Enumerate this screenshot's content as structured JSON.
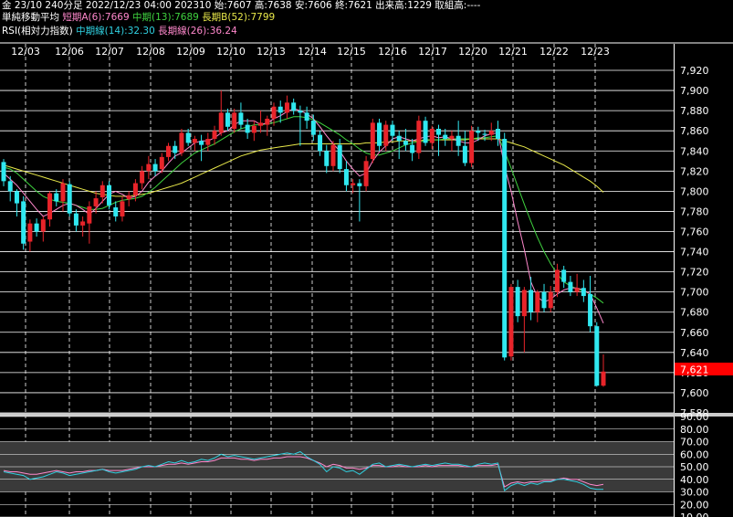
{
  "header": {
    "line1": {
      "instrument": "金 23/10 240分足",
      "datetime": "2022/12/23 04:00",
      "code": "202310",
      "open": "始:7607",
      "high": "高:7638",
      "low": "安:7606",
      "close": "終:7621",
      "volume": "出来高:1229",
      "turnover": "取組高:----"
    },
    "line2": {
      "label": "単純移動平均",
      "short": "短期A(6):7669",
      "mid": "中期(13):7689",
      "long": "長期B(52):7799"
    },
    "line3": {
      "label": "RSI(相対力指数)",
      "mid": "中期線(14):32.30",
      "long": "長期線(26):36.24"
    }
  },
  "colors": {
    "background": "#000000",
    "grid": "#ffffff",
    "candle_up": "#e8242a",
    "candle_down": "#30e8f0",
    "ma_short": "#ff88cc",
    "ma_mid": "#3fd23f",
    "ma_long": "#e8e84a",
    "rsi_mid": "#30d0e0",
    "rsi_long": "#ff88cc",
    "price_marker": "#ff0000"
  },
  "current_price_label": "7,621",
  "chart_data": [
    {
      "type": "candlestick",
      "title": "金 23/10 240分足",
      "date_labels": [
        "12/03",
        "12/06",
        "12/07",
        "12/08",
        "12/09",
        "12/10",
        "12/13",
        "12/14",
        "12/15",
        "12/16",
        "12/17",
        "12/20",
        "12/21",
        "12/22",
        "12/23"
      ],
      "ylim": [
        7580,
        7930
      ],
      "y_ticks": [
        "7,920",
        "7,900",
        "7,880",
        "7,860",
        "7,840",
        "7,820",
        "7,800",
        "7,780",
        "7,760",
        "7,740",
        "7,720",
        "7,700",
        "7,680",
        "7,660",
        "7,640",
        "7,620",
        "7,600",
        "7,580"
      ],
      "candles": [
        {
          "o": 7829,
          "h": 7832,
          "l": 7805,
          "c": 7810
        },
        {
          "o": 7810,
          "h": 7815,
          "l": 7790,
          "c": 7800
        },
        {
          "o": 7800,
          "h": 7802,
          "l": 7775,
          "c": 7788
        },
        {
          "o": 7790,
          "h": 7795,
          "l": 7742,
          "c": 7748
        },
        {
          "o": 7750,
          "h": 7772,
          "l": 7740,
          "c": 7768
        },
        {
          "o": 7768,
          "h": 7773,
          "l": 7755,
          "c": 7760
        },
        {
          "o": 7760,
          "h": 7775,
          "l": 7750,
          "c": 7772
        },
        {
          "o": 7772,
          "h": 7800,
          "l": 7765,
          "c": 7798
        },
        {
          "o": 7798,
          "h": 7802,
          "l": 7785,
          "c": 7790
        },
        {
          "o": 7790,
          "h": 7812,
          "l": 7780,
          "c": 7808
        },
        {
          "o": 7807,
          "h": 7810,
          "l": 7775,
          "c": 7778
        },
        {
          "o": 7778,
          "h": 7782,
          "l": 7760,
          "c": 7766
        },
        {
          "o": 7766,
          "h": 7775,
          "l": 7755,
          "c": 7770
        },
        {
          "o": 7768,
          "h": 7790,
          "l": 7748,
          "c": 7785
        },
        {
          "o": 7785,
          "h": 7800,
          "l": 7778,
          "c": 7793
        },
        {
          "o": 7794,
          "h": 7810,
          "l": 7788,
          "c": 7806
        },
        {
          "o": 7806,
          "h": 7810,
          "l": 7782,
          "c": 7786
        },
        {
          "o": 7784,
          "h": 7790,
          "l": 7770,
          "c": 7775
        },
        {
          "o": 7775,
          "h": 7795,
          "l": 7770,
          "c": 7790
        },
        {
          "o": 7792,
          "h": 7800,
          "l": 7785,
          "c": 7796
        },
        {
          "o": 7796,
          "h": 7812,
          "l": 7790,
          "c": 7808
        },
        {
          "o": 7808,
          "h": 7825,
          "l": 7802,
          "c": 7820
        },
        {
          "o": 7820,
          "h": 7835,
          "l": 7812,
          "c": 7827
        },
        {
          "o": 7827,
          "h": 7832,
          "l": 7815,
          "c": 7820
        },
        {
          "o": 7822,
          "h": 7838,
          "l": 7818,
          "c": 7834
        },
        {
          "o": 7834,
          "h": 7848,
          "l": 7830,
          "c": 7845
        },
        {
          "o": 7845,
          "h": 7850,
          "l": 7832,
          "c": 7838
        },
        {
          "o": 7838,
          "h": 7862,
          "l": 7835,
          "c": 7858
        },
        {
          "o": 7858,
          "h": 7862,
          "l": 7845,
          "c": 7848
        },
        {
          "o": 7848,
          "h": 7855,
          "l": 7840,
          "c": 7852
        },
        {
          "o": 7850,
          "h": 7856,
          "l": 7830,
          "c": 7846
        },
        {
          "o": 7846,
          "h": 7858,
          "l": 7840,
          "c": 7852
        },
        {
          "o": 7852,
          "h": 7865,
          "l": 7846,
          "c": 7860
        },
        {
          "o": 7858,
          "h": 7900,
          "l": 7855,
          "c": 7878
        },
        {
          "o": 7878,
          "h": 7882,
          "l": 7860,
          "c": 7864
        },
        {
          "o": 7862,
          "h": 7882,
          "l": 7858,
          "c": 7878
        },
        {
          "o": 7878,
          "h": 7888,
          "l": 7862,
          "c": 7866
        },
        {
          "o": 7866,
          "h": 7872,
          "l": 7852,
          "c": 7858
        },
        {
          "o": 7858,
          "h": 7870,
          "l": 7850,
          "c": 7865
        },
        {
          "o": 7865,
          "h": 7880,
          "l": 7858,
          "c": 7868
        },
        {
          "o": 7866,
          "h": 7875,
          "l": 7855,
          "c": 7872
        },
        {
          "o": 7872,
          "h": 7888,
          "l": 7865,
          "c": 7884
        },
        {
          "o": 7884,
          "h": 7890,
          "l": 7868,
          "c": 7878
        },
        {
          "o": 7878,
          "h": 7895,
          "l": 7872,
          "c": 7888
        },
        {
          "o": 7888,
          "h": 7892,
          "l": 7876,
          "c": 7880
        },
        {
          "o": 7880,
          "h": 7885,
          "l": 7845,
          "c": 7878
        },
        {
          "o": 7878,
          "h": 7884,
          "l": 7862,
          "c": 7870
        },
        {
          "o": 7870,
          "h": 7876,
          "l": 7850,
          "c": 7856
        },
        {
          "o": 7856,
          "h": 7860,
          "l": 7835,
          "c": 7840
        },
        {
          "o": 7840,
          "h": 7846,
          "l": 7818,
          "c": 7825
        },
        {
          "o": 7825,
          "h": 7850,
          "l": 7820,
          "c": 7846
        },
        {
          "o": 7846,
          "h": 7852,
          "l": 7818,
          "c": 7822
        },
        {
          "o": 7822,
          "h": 7830,
          "l": 7800,
          "c": 7806
        },
        {
          "o": 7806,
          "h": 7812,
          "l": 7798,
          "c": 7808
        },
        {
          "o": 7808,
          "h": 7812,
          "l": 7770,
          "c": 7805
        },
        {
          "o": 7805,
          "h": 7835,
          "l": 7800,
          "c": 7830
        },
        {
          "o": 7832,
          "h": 7872,
          "l": 7828,
          "c": 7868
        },
        {
          "o": 7868,
          "h": 7872,
          "l": 7840,
          "c": 7845
        },
        {
          "o": 7845,
          "h": 7870,
          "l": 7840,
          "c": 7866
        },
        {
          "o": 7866,
          "h": 7870,
          "l": 7850,
          "c": 7855
        },
        {
          "o": 7855,
          "h": 7860,
          "l": 7832,
          "c": 7850
        },
        {
          "o": 7850,
          "h": 7862,
          "l": 7840,
          "c": 7846
        },
        {
          "o": 7846,
          "h": 7852,
          "l": 7830,
          "c": 7838
        },
        {
          "o": 7838,
          "h": 7875,
          "l": 7832,
          "c": 7870
        },
        {
          "o": 7870,
          "h": 7874,
          "l": 7845,
          "c": 7848
        },
        {
          "o": 7848,
          "h": 7865,
          "l": 7842,
          "c": 7862
        },
        {
          "o": 7862,
          "h": 7866,
          "l": 7835,
          "c": 7856
        },
        {
          "o": 7856,
          "h": 7862,
          "l": 7845,
          "c": 7852
        },
        {
          "o": 7852,
          "h": 7860,
          "l": 7840,
          "c": 7855
        },
        {
          "o": 7855,
          "h": 7870,
          "l": 7835,
          "c": 7845
        },
        {
          "o": 7845,
          "h": 7860,
          "l": 7825,
          "c": 7828
        },
        {
          "o": 7828,
          "h": 7865,
          "l": 7824,
          "c": 7860
        },
        {
          "o": 7860,
          "h": 7864,
          "l": 7850,
          "c": 7858
        },
        {
          "o": 7857,
          "h": 7861,
          "l": 7850,
          "c": 7856
        },
        {
          "o": 7856,
          "h": 7868,
          "l": 7850,
          "c": 7860
        },
        {
          "o": 7862,
          "h": 7870,
          "l": 7845,
          "c": 7852
        },
        {
          "o": 7852,
          "h": 7858,
          "l": 7632,
          "c": 7635
        },
        {
          "o": 7636,
          "h": 7708,
          "l": 7632,
          "c": 7705
        },
        {
          "o": 7705,
          "h": 7712,
          "l": 7670,
          "c": 7676
        },
        {
          "o": 7676,
          "h": 7705,
          "l": 7640,
          "c": 7702
        },
        {
          "o": 7702,
          "h": 7715,
          "l": 7672,
          "c": 7680
        },
        {
          "o": 7680,
          "h": 7702,
          "l": 7670,
          "c": 7700
        },
        {
          "o": 7700,
          "h": 7708,
          "l": 7680,
          "c": 7684
        },
        {
          "o": 7684,
          "h": 7706,
          "l": 7680,
          "c": 7700
        },
        {
          "o": 7700,
          "h": 7728,
          "l": 7695,
          "c": 7722
        },
        {
          "o": 7722,
          "h": 7726,
          "l": 7704,
          "c": 7710
        },
        {
          "o": 7710,
          "h": 7716,
          "l": 7696,
          "c": 7700
        },
        {
          "o": 7700,
          "h": 7718,
          "l": 7696,
          "c": 7704
        },
        {
          "o": 7704,
          "h": 7712,
          "l": 7690,
          "c": 7696
        },
        {
          "o": 7698,
          "h": 7716,
          "l": 7660,
          "c": 7666
        },
        {
          "o": 7666,
          "h": 7670,
          "l": 7606,
          "c": 7607
        },
        {
          "o": 7607,
          "h": 7638,
          "l": 7606,
          "c": 7621
        }
      ],
      "ma_short_6": [
        7818,
        7812,
        7806,
        7798,
        7790,
        7782,
        7775,
        7778,
        7782,
        7786,
        7788,
        7786,
        7782,
        7777,
        7783,
        7790,
        7797,
        7800,
        7797,
        7793,
        7795,
        7800,
        7809,
        7815,
        7820,
        7828,
        7835,
        7838,
        7843,
        7848,
        7850,
        7850,
        7853,
        7858,
        7860,
        7866,
        7870,
        7870,
        7870,
        7866,
        7868,
        7872,
        7875,
        7879,
        7882,
        7880,
        7877,
        7872,
        7864,
        7855,
        7847,
        7840,
        7830,
        7822,
        7815,
        7818,
        7830,
        7839,
        7845,
        7852,
        7854,
        7852,
        7850,
        7852,
        7854,
        7855,
        7853,
        7854,
        7852,
        7850,
        7848,
        7848,
        7851,
        7855,
        7857,
        7858,
        7825,
        7800,
        7770,
        7742,
        7710,
        7695,
        7690,
        7693,
        7698,
        7702,
        7704,
        7704,
        7702,
        7698,
        7684,
        7669
      ],
      "ma_mid_13": [
        7824,
        7822,
        7818,
        7812,
        7806,
        7800,
        7795,
        7792,
        7790,
        7789,
        7788,
        7786,
        7784,
        7782,
        7782,
        7783,
        7786,
        7789,
        7791,
        7792,
        7793,
        7795,
        7799,
        7804,
        7810,
        7816,
        7822,
        7828,
        7833,
        7838,
        7841,
        7844,
        7847,
        7851,
        7855,
        7859,
        7862,
        7864,
        7866,
        7866,
        7867,
        7868,
        7870,
        7872,
        7874,
        7874,
        7873,
        7871,
        7868,
        7864,
        7860,
        7856,
        7851,
        7847,
        7842,
        7838,
        7836,
        7836,
        7838,
        7840,
        7843,
        7846,
        7848,
        7849,
        7850,
        7851,
        7851,
        7852,
        7852,
        7852,
        7852,
        7852,
        7853,
        7853,
        7854,
        7855,
        7840,
        7823,
        7805,
        7787,
        7770,
        7754,
        7740,
        7728,
        7718,
        7710,
        7706,
        7703,
        7701,
        7698,
        7694,
        7689
      ],
      "ma_long_52": [
        7826,
        7824,
        7822,
        7820,
        7818,
        7816,
        7814,
        7812,
        7810,
        7808,
        7806,
        7804,
        7802,
        7800,
        7798,
        7797,
        7796,
        7795,
        7795,
        7795,
        7796,
        7797,
        7798,
        7800,
        7802,
        7804,
        7806,
        7808,
        7811,
        7814,
        7817,
        7820,
        7823,
        7826,
        7829,
        7832,
        7835,
        7837,
        7839,
        7841,
        7842,
        7843,
        7844,
        7845,
        7846,
        7847,
        7847,
        7847,
        7847,
        7847,
        7847,
        7847,
        7847,
        7847,
        7847,
        7848,
        7848,
        7848,
        7849,
        7849,
        7850,
        7850,
        7850,
        7850,
        7851,
        7851,
        7851,
        7851,
        7851,
        7851,
        7851,
        7852,
        7852,
        7852,
        7852,
        7852,
        7850,
        7848,
        7846,
        7844,
        7841,
        7838,
        7835,
        7832,
        7829,
        7826,
        7822,
        7818,
        7814,
        7810,
        7805,
        7799
      ]
    },
    {
      "type": "line",
      "title": "RSI(相対力指数)",
      "ylim": [
        10,
        90
      ],
      "y_ticks": [
        "90.00",
        "80.00",
        "70.00",
        "60.00",
        "50.00",
        "40.00",
        "30.00",
        "20.00",
        "10.00"
      ],
      "series": [
        {
          "name": "中期線(14)",
          "values": [
            46,
            45,
            44,
            43,
            40,
            41,
            42,
            44,
            46,
            45,
            43,
            44,
            45,
            46,
            47,
            48,
            46,
            45,
            46,
            47,
            48,
            50,
            51,
            50,
            52,
            54,
            53,
            55,
            53,
            54,
            56,
            55,
            57,
            60,
            58,
            59,
            58,
            57,
            56,
            57,
            58,
            59,
            60,
            61,
            60,
            62,
            58,
            55,
            52,
            46,
            50,
            49,
            46,
            47,
            44,
            48,
            52,
            53,
            50,
            51,
            52,
            51,
            50,
            51,
            52,
            51,
            52,
            53,
            52,
            52,
            51,
            50,
            52,
            53,
            52,
            53,
            31,
            35,
            37,
            35,
            37,
            36,
            38,
            38,
            40,
            40,
            39,
            38,
            36,
            33,
            32,
            32
          ]
        },
        {
          "name": "長期線(26)",
          "values": [
            47,
            46,
            46,
            45,
            44,
            44,
            45,
            46,
            47,
            46,
            45,
            46,
            46,
            47,
            47,
            48,
            47,
            47,
            47,
            48,
            49,
            50,
            50,
            50,
            51,
            52,
            52,
            53,
            52,
            53,
            54,
            54,
            55,
            57,
            57,
            57,
            56,
            56,
            55,
            56,
            56,
            57,
            57,
            58,
            58,
            58,
            57,
            55,
            53,
            50,
            52,
            51,
            49,
            49,
            48,
            49,
            51,
            51,
            50,
            50,
            51,
            50,
            50,
            50,
            51,
            50,
            51,
            51,
            51,
            51,
            50,
            50,
            51,
            51,
            51,
            52,
            34,
            37,
            38,
            37,
            38,
            38,
            39,
            39,
            40,
            41,
            40,
            40,
            38,
            36,
            35,
            36
          ]
        }
      ]
    }
  ]
}
